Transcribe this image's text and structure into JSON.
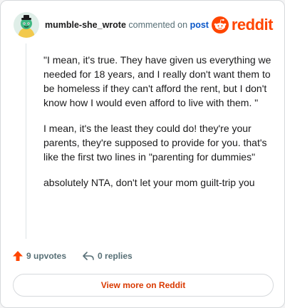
{
  "comment": {
    "username": "mumble-she_wrote",
    "action_text": " commented on ",
    "post_link_text": "post",
    "paragraphs": [
      "\"I mean, it's true. They have given us everything we needed for 18 years, and I really don't want them to be homeless if they can't afford the rent, but I don't know how I would even afford to live with them. \"",
      "I mean, it's the least they could do! they're your parents, they're supposed to provide for you. that's like the first two lines in \"parenting for dummies\"",
      "absolutely NTA, don't let your mom guilt-trip you"
    ]
  },
  "brand": {
    "wordmark": "reddit",
    "icon": "reddit-snoo-icon",
    "color": "#ff4500"
  },
  "actions": {
    "upvotes_label": "9 upvotes",
    "replies_label": "0 replies",
    "upvote_icon": "upvote-arrow-icon",
    "reply_icon": "reply-arrow-icon",
    "upvote_color": "#ff4500"
  },
  "footer": {
    "view_more_label": "View more on Reddit",
    "link_color": "#d93900"
  }
}
